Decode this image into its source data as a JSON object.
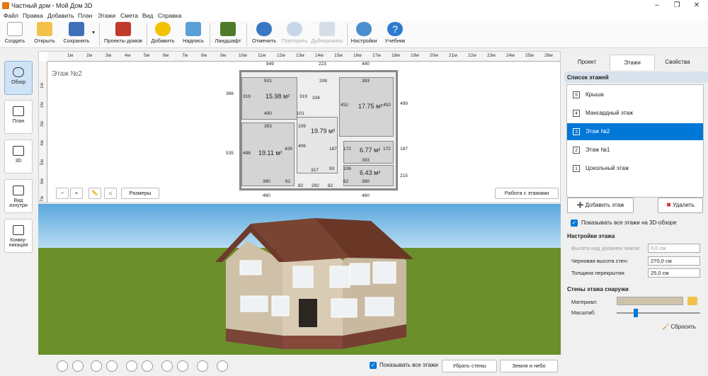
{
  "window": {
    "title": "Частный дом - Мой Дом 3D"
  },
  "menu": [
    "Файл",
    "Правка",
    "Добавить",
    "План",
    "Этажи",
    "Смета",
    "Вид",
    "Справка"
  ],
  "toolbar": {
    "create": "Создать",
    "open": "Открыть",
    "save": "Сохранить",
    "projects": "Проекты домов",
    "add": "Добавить",
    "label": "Надпись",
    "landscape": "Ландшафт",
    "undo": "Отменить",
    "redo": "Повторить",
    "duplicate": "Дублировать",
    "settings": "Настройки",
    "tutorial": "Учебник"
  },
  "leftbar": {
    "overview": "Обзор",
    "plan": "План",
    "view3d": "3D",
    "inside": "Вид изнутри",
    "comms": "Комму-никации"
  },
  "plan": {
    "floor_label": "Этаж №2",
    "ruler_top": [
      "1м",
      "2м",
      "3м",
      "4м",
      "5м",
      "6м",
      "7м",
      "8м",
      "9м",
      "10м",
      "11м",
      "12м",
      "13м",
      "14м",
      "15м",
      "16м",
      "17м",
      "18м",
      "19м",
      "20м",
      "21м",
      "22м",
      "23м",
      "24м",
      "25м",
      "26м"
    ],
    "ruler_left": [
      "1м",
      "2м",
      "3м",
      "4м",
      "5м",
      "6м",
      "7м"
    ],
    "areas": [
      "15.98 м²",
      "17.75 м²",
      "19.79 м²",
      "19.11 м²",
      "6.77 м²",
      "6.43 м²"
    ],
    "dims": [
      "949",
      "223",
      "440",
      "501",
      "208",
      "393",
      "319",
      "319",
      "334",
      "452",
      "452",
      "499",
      "366",
      "400",
      "101",
      "393",
      "109",
      "535",
      "488",
      "426",
      "406",
      "187",
      "172",
      "172",
      "187",
      "317",
      "93",
      "106",
      "393",
      "380",
      "62",
      "82",
      "292",
      "82",
      "62",
      "380",
      "215",
      "460",
      "460"
    ],
    "sizes_btn": "Размеры",
    "floors_btn": "Работа с этажами"
  },
  "bottombar": {
    "show_all": "Показывать все этажи",
    "remove_walls": "Убрать стены",
    "ground_sky": "Земля и небо"
  },
  "rightpanel": {
    "tabs": [
      "Проект",
      "Этажи",
      "Свойства"
    ],
    "list_header": "Список этажей",
    "floors": [
      {
        "num": "5",
        "name": "Крыша"
      },
      {
        "num": "4",
        "name": "Мансардный этаж"
      },
      {
        "num": "3",
        "name": "Этаж №2"
      },
      {
        "num": "2",
        "name": "Этаж №1"
      },
      {
        "num": "1",
        "name": "Цокольный этаж"
      }
    ],
    "add_floor": "Добавить этаж",
    "delete": "Удалить",
    "show_all_3d": "Показывать все этажи на 3D-обзоре",
    "settings_header": "Настройки этажа",
    "height_label": "Высота над уровнем земли:",
    "height_value": "0,0 см",
    "rough_label": "Черновая высота стен:",
    "rough_value": "270,0 см",
    "slab_label": "Толщина перекрытия:",
    "slab_value": "25,0 см",
    "walls_header": "Стены этажа снаружи",
    "material_label": "Материал:",
    "scale_label": "Масштаб:",
    "reset": "Сбросить"
  },
  "colors": {
    "accent": "#0078d7",
    "sky": "#6fb4e0",
    "grass": "#6b8f2a",
    "house_wall": "#cfc0a8",
    "roof": "#6e3a2a"
  }
}
